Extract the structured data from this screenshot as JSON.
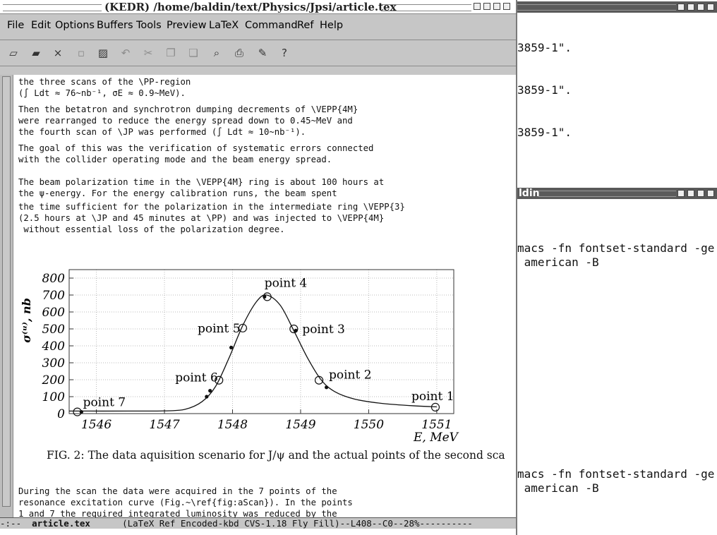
{
  "emacs": {
    "title": "(KEDR) /home/baldin/text/Physics/Jpsi/article.tex",
    "menu": [
      "File",
      "Edit",
      "Options",
      "Buffers",
      "Tools",
      "Preview",
      "LaTeX",
      "Command",
      "Ref",
      "Help"
    ],
    "toolbar": [
      {
        "icon": "new-file-icon",
        "glyph": "▱"
      },
      {
        "icon": "open-folder-icon",
        "glyph": "▰"
      },
      {
        "icon": "close-icon",
        "glyph": "×"
      },
      {
        "icon": "save-icon",
        "glyph": "▫"
      },
      {
        "icon": "save-as-icon",
        "glyph": "▨"
      },
      {
        "icon": "undo-icon",
        "glyph": "↶"
      },
      {
        "icon": "cut-icon",
        "glyph": "✂"
      },
      {
        "icon": "copy-icon",
        "glyph": "❐"
      },
      {
        "icon": "paste-icon",
        "glyph": "❏"
      },
      {
        "icon": "search-icon",
        "glyph": "⌕"
      },
      {
        "icon": "print-icon",
        "glyph": "⎙"
      },
      {
        "icon": "preferences-icon",
        "glyph": "✎"
      },
      {
        "icon": "help-icon",
        "glyph": "?"
      }
    ],
    "lines": [
      "the three scans of the \\PP-region",
      "(∫ Ldt ≈ 76~nb⁻¹, σE ≈ 0.9~MeV).",
      "Then the betatron and synchrotron dumping decrements of \\VEPP{4M}",
      "were rearranged to reduce the energy spread down to 0.45~MeV and",
      "the fourth scan of \\JP was performed (∫ Ldt ≈ 10~nb⁻¹).",
      "The goal of this was the verification of systematic errors connected",
      "with the collider operating mode and the beam energy spread.",
      "",
      "The beam polarization time in the \\VEPP{4M} ring is about 100 hours at",
      "the ψ-energy. For the energy calibration runs, the beam spent",
      "the time sufficient for the polarization in the intermediate ring \\VEPP{3}",
      "(2.5 hours at \\JP and 45 minutes at \\PP) and was injected to \\VEPP{4M}",
      " without essential loss of the polarization degree."
    ],
    "bottom_lines": [
      "During the scan the data were acquired in the 7 points of the",
      "resonance excitation curve (Fig.~\\ref{fig:aScan}). In the points",
      "1 and 7 the required integrated luminosity was reduced by the"
    ],
    "caption": "FIG. 2: The data aquisition scenario for J/ψ and the actual points of the second sca",
    "modeline": "-:--  ",
    "modeline_buffer": "article.tex",
    "modeline_rest": "      (LaTeX Ref Encoded-kbd CVS-1.18 Fly Fill)--L408--C0--28%----------"
  },
  "chart_data": {
    "type": "line",
    "title": "",
    "xlabel": "E, MeV",
    "ylabel": "σ⁽ᵘ⁾, nb",
    "xlim": [
      1545.6,
      1551.25
    ],
    "ylim": [
      0,
      850
    ],
    "xticks": [
      1546,
      1547,
      1548,
      1549,
      1550,
      1551
    ],
    "yticks": [
      0,
      100,
      200,
      300,
      400,
      500,
      600,
      700,
      800
    ],
    "grid": true,
    "curve": [
      [
        1545.6,
        15
      ],
      [
        1546.5,
        15
      ],
      [
        1547.0,
        16
      ],
      [
        1547.3,
        25
      ],
      [
        1547.55,
        70
      ],
      [
        1547.75,
        160
      ],
      [
        1547.95,
        330
      ],
      [
        1548.15,
        520
      ],
      [
        1548.35,
        660
      ],
      [
        1548.5,
        700
      ],
      [
        1548.7,
        640
      ],
      [
        1548.9,
        490
      ],
      [
        1549.1,
        330
      ],
      [
        1549.3,
        200
      ],
      [
        1549.5,
        130
      ],
      [
        1549.8,
        85
      ],
      [
        1550.2,
        60
      ],
      [
        1550.7,
        45
      ],
      [
        1551.0,
        40
      ]
    ],
    "points": [
      {
        "label": "point 1",
        "x": 1550.98,
        "y": 38
      },
      {
        "label": "point 2",
        "x": 1549.27,
        "y": 197
      },
      {
        "label": "point 3",
        "x": 1548.9,
        "y": 500
      },
      {
        "label": "point 4",
        "x": 1548.51,
        "y": 690
      },
      {
        "label": "point 5",
        "x": 1548.15,
        "y": 505
      },
      {
        "label": "point 6",
        "x": 1547.8,
        "y": 197
      },
      {
        "label": "point 7",
        "x": 1545.72,
        "y": 10
      }
    ],
    "measured": [
      [
        1547.62,
        100
      ],
      [
        1547.67,
        135
      ],
      [
        1547.98,
        390
      ],
      [
        1548.47,
        690
      ],
      [
        1548.93,
        490
      ],
      [
        1549.38,
        155
      ],
      [
        1545.78,
        10
      ]
    ]
  },
  "xterm_top": {
    "lines": [
      "3859-1\".",
      "3859-1\".",
      "3859-1\"."
    ]
  },
  "xterm_bottom": {
    "title": "ldin",
    "lines_a": [
      "macs -fn fontset-standard -ge",
      " american -B"
    ],
    "lines_b": [
      "macs -fn fontset-standard -ge",
      " american -B"
    ]
  }
}
